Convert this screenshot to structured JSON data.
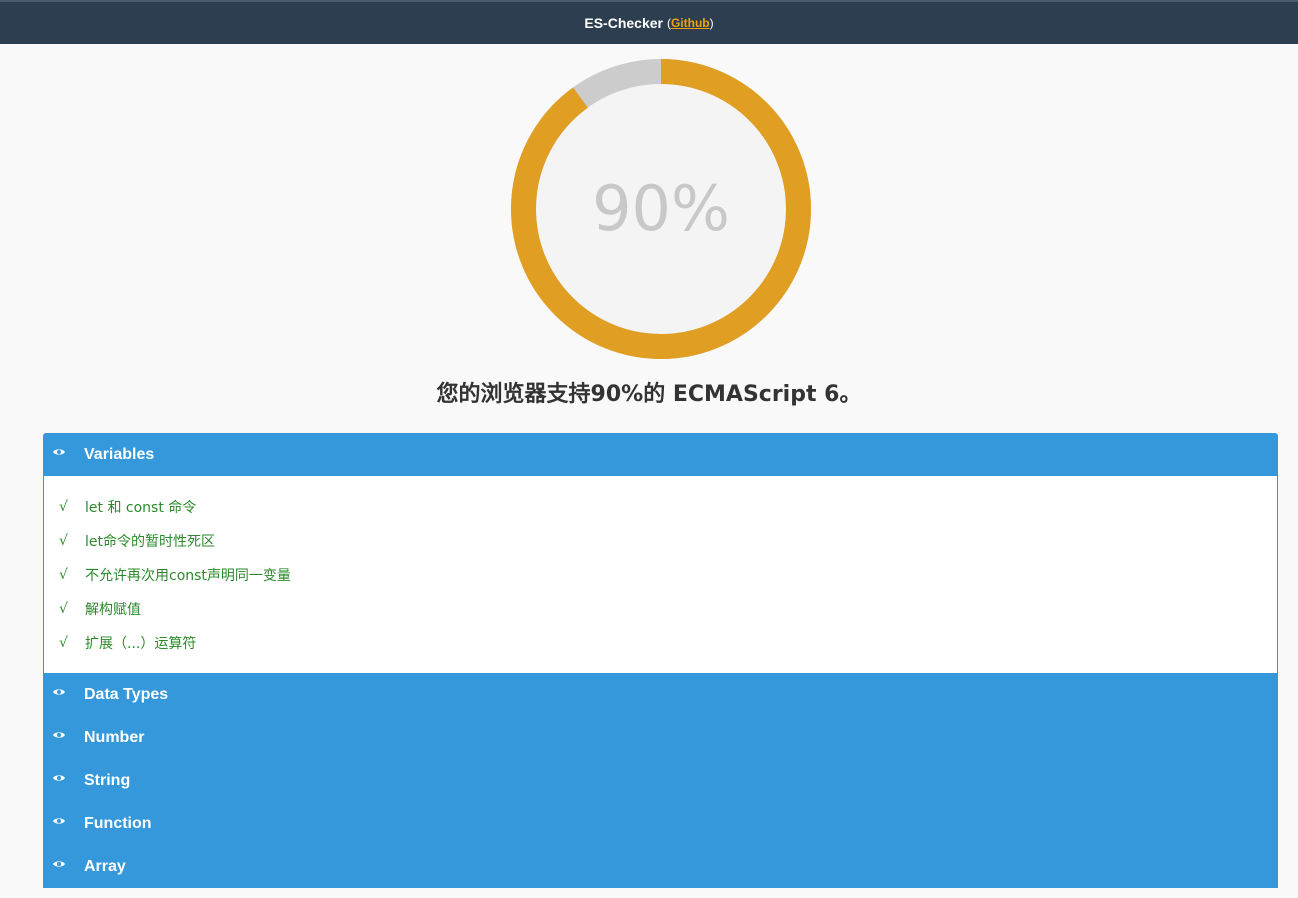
{
  "header": {
    "brand": "ES-Checker",
    "open_paren": "(",
    "link_text": "Github",
    "close_paren": ")"
  },
  "progress": {
    "percent": 90,
    "label": "90%",
    "fill_color": "#e09e22",
    "track_color": "#cccccc",
    "inner_color": "#f4f4f4"
  },
  "summary_text": "您的浏览器支持90%的 ECMAScript 6。",
  "icons": {
    "section_icon": "eye-icon",
    "item_icon": "check-icon"
  },
  "check_glyph": "√",
  "sections": [
    {
      "title": "Variables",
      "expanded": true,
      "items": [
        "let 和 const 命令",
        "let命令的暂时性死区",
        "不允许再次用const声明同一变量",
        "解构赋值",
        "扩展（...）运算符"
      ]
    },
    {
      "title": "Data Types",
      "expanded": false
    },
    {
      "title": "Number",
      "expanded": false
    },
    {
      "title": "String",
      "expanded": false
    },
    {
      "title": "Function",
      "expanded": false
    },
    {
      "title": "Array",
      "expanded": false
    }
  ],
  "colors": {
    "topbar": "#2d3e50",
    "accent": "#3498db",
    "pass_text": "#2a8a2a",
    "link": "#f0a30a"
  }
}
